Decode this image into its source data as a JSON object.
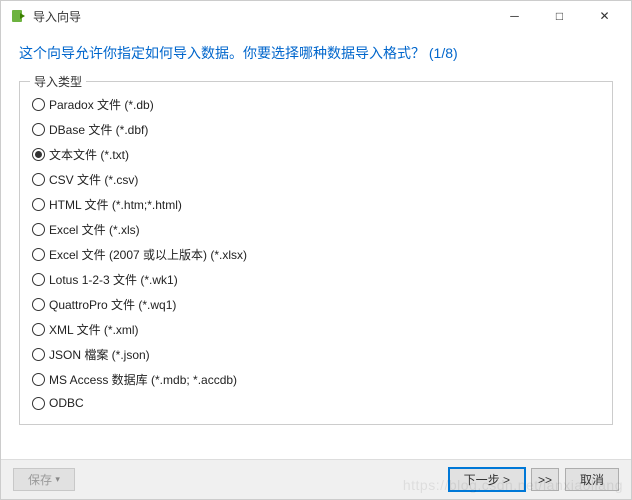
{
  "window": {
    "title": "导入向导",
    "minimize_glyph": "─",
    "maximize_glyph": "□",
    "close_glyph": "✕"
  },
  "headline": "这个向导允许你指定如何导入数据。你要选择哪种数据导入格式？ (1/8)",
  "group": {
    "legend": "导入类型",
    "options": [
      {
        "label": "Paradox 文件 (*.db)",
        "selected": false
      },
      {
        "label": "DBase 文件 (*.dbf)",
        "selected": false
      },
      {
        "label": "文本文件 (*.txt)",
        "selected": true
      },
      {
        "label": "CSV 文件 (*.csv)",
        "selected": false
      },
      {
        "label": "HTML 文件 (*.htm;*.html)",
        "selected": false
      },
      {
        "label": "Excel 文件 (*.xls)",
        "selected": false
      },
      {
        "label": "Excel 文件 (2007 或以上版本) (*.xlsx)",
        "selected": false
      },
      {
        "label": "Lotus 1-2-3 文件 (*.wk1)",
        "selected": false
      },
      {
        "label": "QuattroPro 文件 (*.wq1)",
        "selected": false
      },
      {
        "label": "XML 文件 (*.xml)",
        "selected": false
      },
      {
        "label": "JSON 檔案 (*.json)",
        "selected": false
      },
      {
        "label": "MS Access 数据库 (*.mdb; *.accdb)",
        "selected": false
      },
      {
        "label": "ODBC",
        "selected": false
      }
    ]
  },
  "footer": {
    "save_label": "保存",
    "save_caret": "▾",
    "next_label": "下一步 >",
    "expand_label": ">>",
    "cancel_label": "取消"
  },
  "watermark": "https://blog.csdn.net/lanxiaoliang"
}
